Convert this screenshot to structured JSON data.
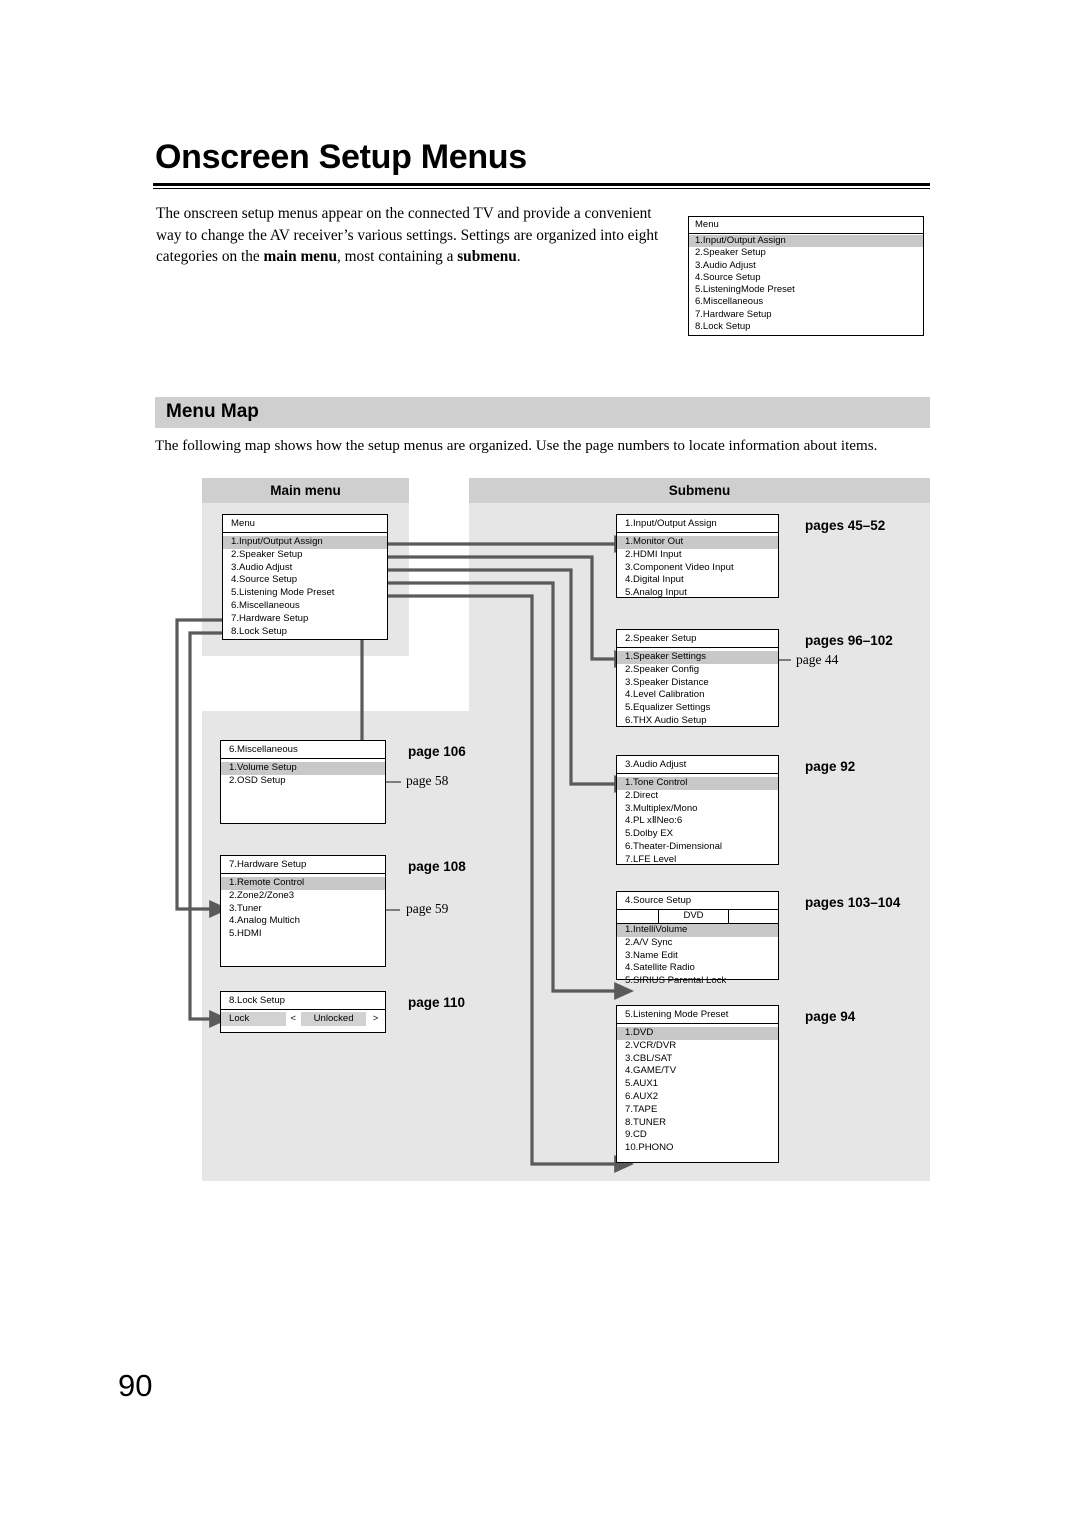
{
  "document": {
    "title": "Onscreen Setup Menus",
    "page_number": "90",
    "intro_paragraph_part1": "The onscreen setup menus appear on the connected TV and provide a convenient way to change the AV receiver’s various settings. Settings are organized into eight categories on the ",
    "intro_bold_1": "main menu",
    "intro_paragraph_part2": ", most containing a ",
    "intro_bold_2": "submenu",
    "intro_paragraph_part3": "."
  },
  "osd_top": {
    "title": "Menu",
    "items": [
      "1.Input/Output Assign",
      "2.Speaker Setup",
      "3.Audio Adjust",
      "4.Source Setup",
      "5.ListeningMode Preset",
      "6.Miscellaneous",
      "7.Hardware Setup",
      "8.Lock Setup"
    ],
    "selected_index": 0
  },
  "menu_map": {
    "section_title": "Menu Map",
    "intro": "The following map shows how the setup menus are organized. Use the page numbers to locate information about items.",
    "column_headers": {
      "main": "Main menu",
      "sub": "Submenu"
    },
    "main_menu_box": {
      "title": "Menu",
      "items": [
        "1.Input/Output Assign",
        "2.Speaker Setup",
        "3.Audio Adjust",
        "4.Source Setup",
        "5.Listening Mode Preset",
        "6.Miscellaneous",
        "7.Hardware Setup",
        "8.Lock Setup"
      ],
      "selected_index": 0
    },
    "left_boxes": [
      {
        "title": "6.Miscellaneous",
        "items": [
          "1.Volume Setup",
          "2.OSD Setup"
        ],
        "selected_index": 0,
        "page_ref": "page 106",
        "sub_ref": "page 58"
      },
      {
        "title": "7.Hardware Setup",
        "items": [
          "1.Remote Control",
          "2.Zone2/Zone3",
          "3.Tuner",
          "4.Analog Multich",
          "5.HDMI"
        ],
        "selected_index": 0,
        "page_ref": "page 108",
        "sub_ref": "page 59"
      },
      {
        "title": "8.Lock Setup",
        "items": [],
        "lock_row": {
          "label": "Lock",
          "left_arrow": "<",
          "value": "Unlocked",
          "right_arrow": ">"
        },
        "page_ref": "page 110",
        "sub_ref": ""
      }
    ],
    "right_boxes": [
      {
        "title": "1.Input/Output Assign",
        "items": [
          "1.Monitor Out",
          "2.HDMI Input",
          "3.Component Video Input",
          "4.Digital Input",
          "5.Analog Input"
        ],
        "selected_index": 0,
        "page_ref": "pages 45–52",
        "sub_ref": ""
      },
      {
        "title": "2.Speaker Setup",
        "items": [
          "1.Speaker Settings",
          "2.Speaker Config",
          "3.Speaker Distance",
          "4.Level Calibration",
          "5.Equalizer Settings",
          "6.THX Audio Setup"
        ],
        "selected_index": 0,
        "page_ref": "pages 96–102",
        "sub_ref": "page 44"
      },
      {
        "title": "3.Audio Adjust",
        "items": [
          "1.Tone Control",
          "2.Direct",
          "3.Multiplex/Mono",
          "4.PL xⅡNeo:6",
          "5.Dolby EX",
          "6.Theater-Dimensional",
          "7.LFE Level"
        ],
        "selected_index": 0,
        "page_ref": "page 92",
        "sub_ref": ""
      },
      {
        "title": "4.Source Setup",
        "tab": "DVD",
        "items": [
          "1.IntelliVolume",
          "2.A/V Sync",
          "3.Name Edit",
          "4.Satellite Radio",
          "5.SIRIUS Parental Lock"
        ],
        "selected_index": 0,
        "page_ref": "pages 103–104",
        "sub_ref": ""
      },
      {
        "title": "5.Listening Mode Preset",
        "items": [
          "1.DVD",
          "2.VCR/DVR",
          "3.CBL/SAT",
          "4.GAME/TV",
          "5.AUX1",
          "6.AUX2",
          "7.TAPE",
          "8.TUNER",
          "9.CD",
          "10.PHONO"
        ],
        "selected_index": 0,
        "page_ref": "page 94",
        "sub_ref": ""
      }
    ]
  },
  "colors": {
    "panel_gray": "#e6e6e6",
    "header_gray": "#cfcfcf",
    "selection_gray": "#c8c8c8",
    "wire": "#5a5a5a"
  }
}
